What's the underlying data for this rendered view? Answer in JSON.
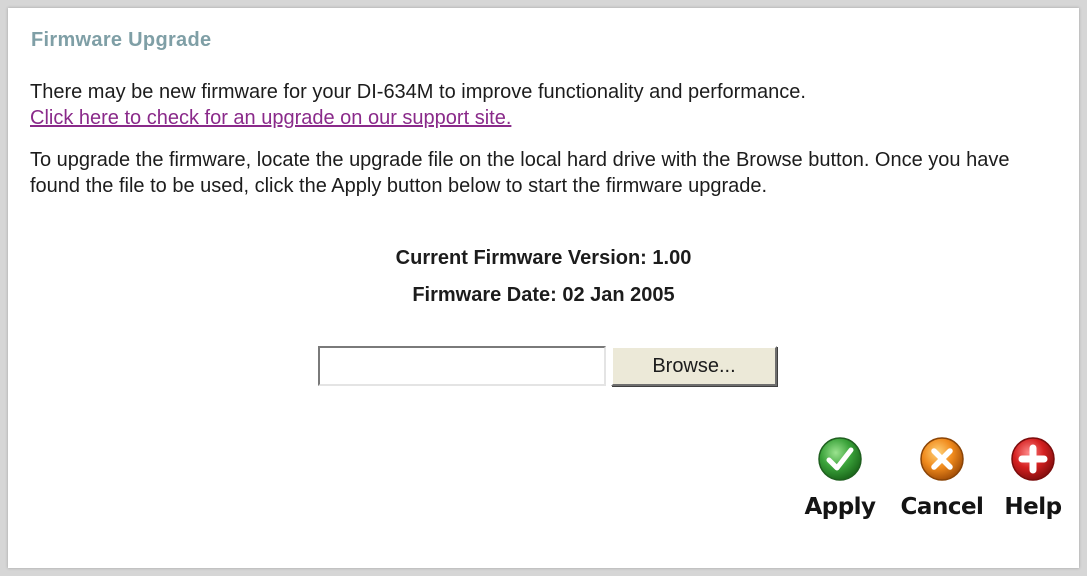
{
  "page": {
    "title": "Firmware Upgrade",
    "intro_text": "There may be new firmware for your DI-634M to improve functionality and performance.",
    "support_link": "Click here to check for an upgrade on our support site.",
    "instructions": "To upgrade the firmware, locate the upgrade file on the local hard drive with the Browse button. Once you have found the file to be used, click the Apply button below to start the firmware upgrade."
  },
  "firmware": {
    "version_line": "Current Firmware Version: 1.00",
    "date_line": "Firmware Date: 02 Jan 2005"
  },
  "upload": {
    "file_value": "",
    "browse_label": "Browse..."
  },
  "actions": {
    "apply_label": "Apply",
    "cancel_label": "Cancel",
    "help_label": "Help"
  },
  "colors": {
    "title": "#7f9fa6",
    "link": "#8a2a8a",
    "apply_icon": "#3aa23a",
    "cancel_icon": "#f08a1c",
    "help_icon": "#d42020"
  },
  "icons": {
    "apply": "checkmark-icon",
    "cancel": "x-icon",
    "help": "plus-icon"
  }
}
